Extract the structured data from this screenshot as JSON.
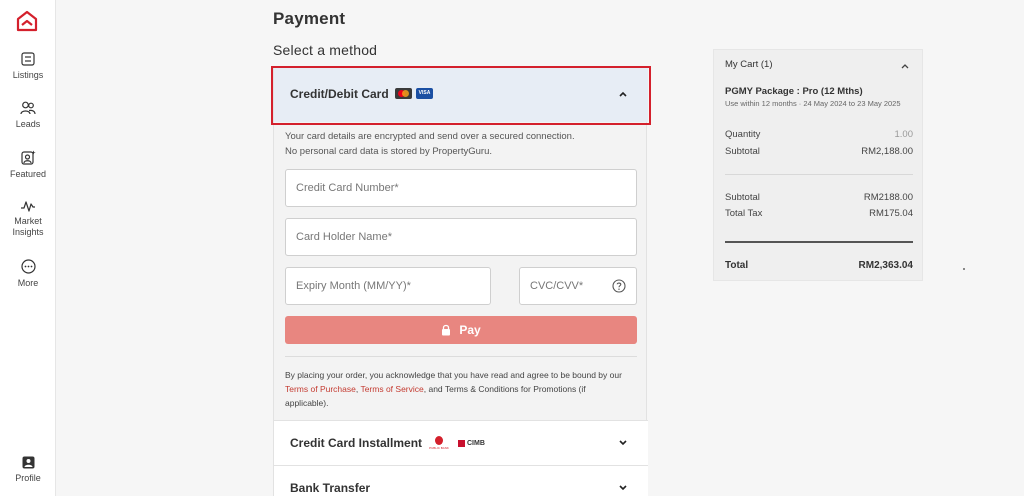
{
  "sidebar": {
    "items": [
      {
        "label": "Listings",
        "icon": "listings-icon"
      },
      {
        "label": "Leads",
        "icon": "leads-icon"
      },
      {
        "label": "Featured",
        "icon": "featured-icon"
      },
      {
        "label": "Market Insights",
        "icon": "market-insights-icon"
      },
      {
        "label": "More",
        "icon": "more-icon"
      }
    ],
    "profile_label": "Profile"
  },
  "header": {
    "title": "Payment",
    "section_title": "Select a method"
  },
  "payment": {
    "card_method": {
      "label": "Credit/Debit Card",
      "visa_text": "VISA",
      "expanded": true,
      "notice_line1": "Your card details are encrypted and send over a secured connection.",
      "notice_line2": "No personal card data is stored by PropertyGuru."
    },
    "fields": {
      "card_number_placeholder": "Credit Card Number*",
      "holder_name_placeholder": "Card Holder Name*",
      "expiry_placeholder": "Expiry Month (MM/YY)*",
      "cvc_placeholder": "CVC/CVV*"
    },
    "pay_label": "Pay",
    "terms": {
      "prefix": "By placing your order, you acknowledge that you have read and agree to be bound by our ",
      "link1": "Terms of Purchase",
      "sep": ", ",
      "link2": "Terms of Service",
      "suffix": ", and Terms & Conditions for Promotions (if applicable)."
    },
    "installment": {
      "label": "Credit Card Installment",
      "public_bank_text": "PUBLIC BANK",
      "cimb_text": "CIMB"
    },
    "bank_transfer": {
      "label": "Bank Transfer"
    }
  },
  "cart": {
    "title": "My Cart (1)",
    "package_name": "PGMY Package : Pro (12 Mths)",
    "package_validity": "Use within 12 months · 24 May 2024 to 23 May 2025",
    "quantity_label": "Quantity",
    "quantity_value": "1.00",
    "subtotal_label": "Subtotal",
    "subtotal_value": "RM2,188.00",
    "summary_subtotal_label": "Subtotal",
    "summary_subtotal_value": "RM2188.00",
    "tax_label": "Total Tax",
    "tax_value": "RM175.04",
    "total_label": "Total",
    "total_value": "RM2,363.04"
  },
  "colors": {
    "accent": "#d4202c",
    "pay_button": "#e88680",
    "selected_method_bg": "#e7edf5",
    "link": "#c43b31"
  }
}
